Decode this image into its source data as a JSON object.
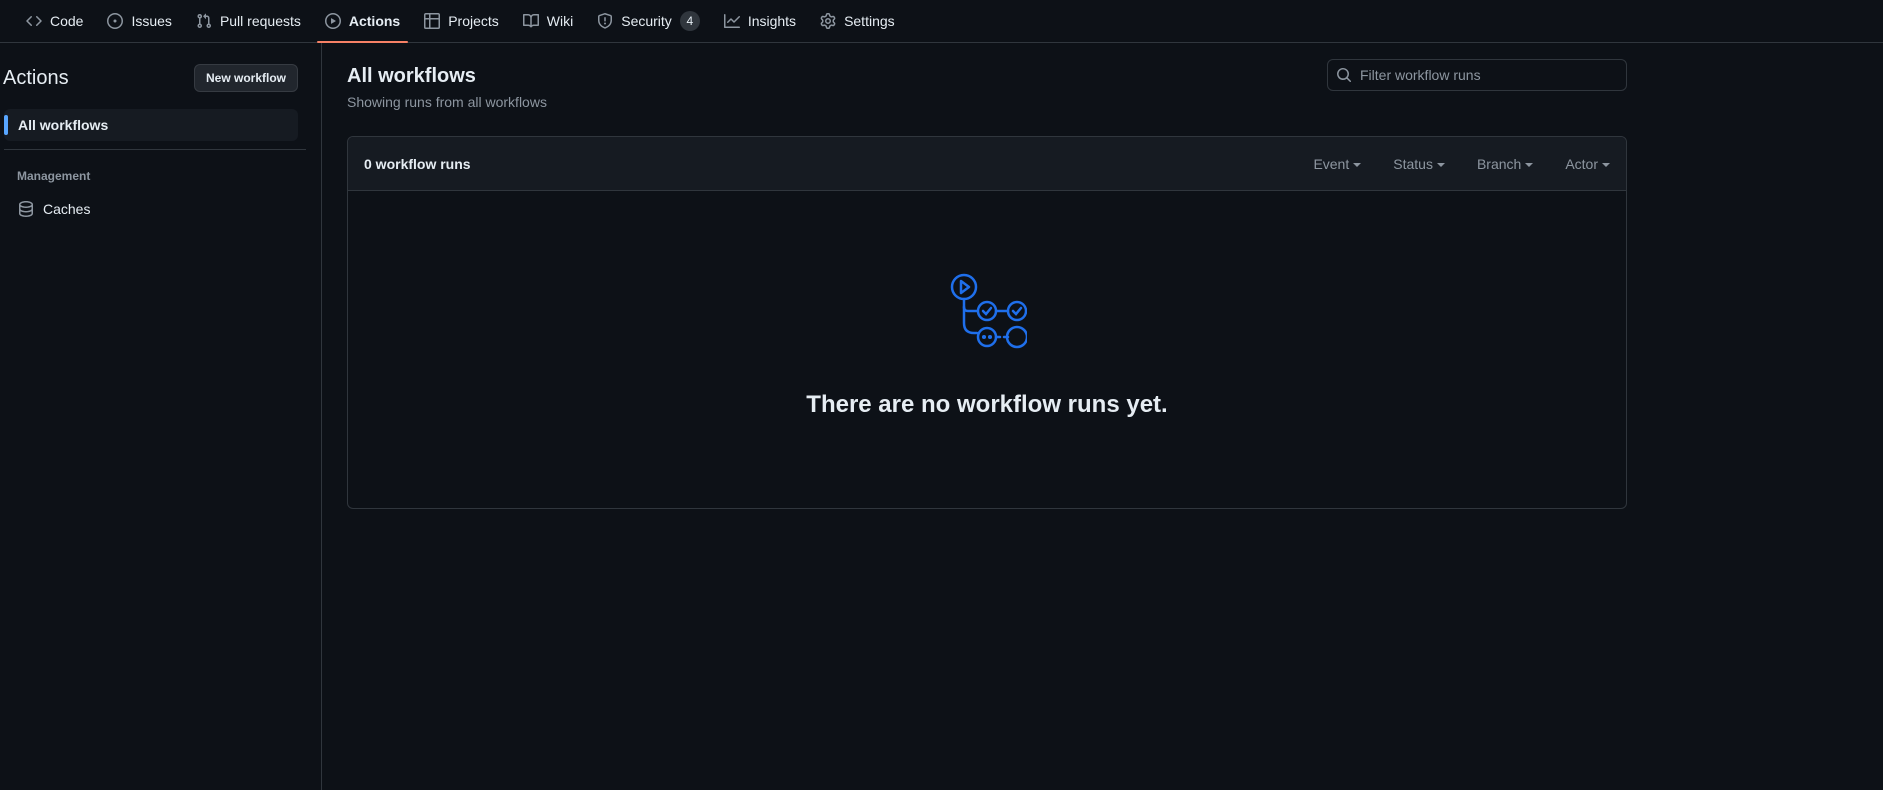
{
  "nav": {
    "tabs": [
      {
        "label": "Code",
        "icon": "code-icon"
      },
      {
        "label": "Issues",
        "icon": "issue-opened-icon"
      },
      {
        "label": "Pull requests",
        "icon": "git-pull-request-icon"
      },
      {
        "label": "Actions",
        "icon": "play-icon",
        "selected": true
      },
      {
        "label": "Projects",
        "icon": "table-icon"
      },
      {
        "label": "Wiki",
        "icon": "book-icon"
      },
      {
        "label": "Security",
        "icon": "shield-icon",
        "counter": "4"
      },
      {
        "label": "Insights",
        "icon": "graph-icon"
      },
      {
        "label": "Settings",
        "icon": "gear-icon"
      }
    ]
  },
  "sidebar": {
    "title": "Actions",
    "new_workflow_label": "New workflow",
    "active_item": "All workflows",
    "section_heading": "Management",
    "caches_label": "Caches",
    "caches_icon": "database-icon"
  },
  "main": {
    "title": "All workflows",
    "subtitle": "Showing runs from all workflows",
    "filter_placeholder": "Filter workflow runs",
    "runs_count": "0 workflow runs",
    "filters": [
      "Event",
      "Status",
      "Branch",
      "Actor"
    ],
    "empty_message": "There are no workflow runs yet.",
    "empty_icon": "workflow-illustration-icon"
  },
  "colors": {
    "background": "#0d1117",
    "accent_underline": "#f78166",
    "active_bar": "#58a6ff",
    "illustration": "#1f6feb"
  }
}
